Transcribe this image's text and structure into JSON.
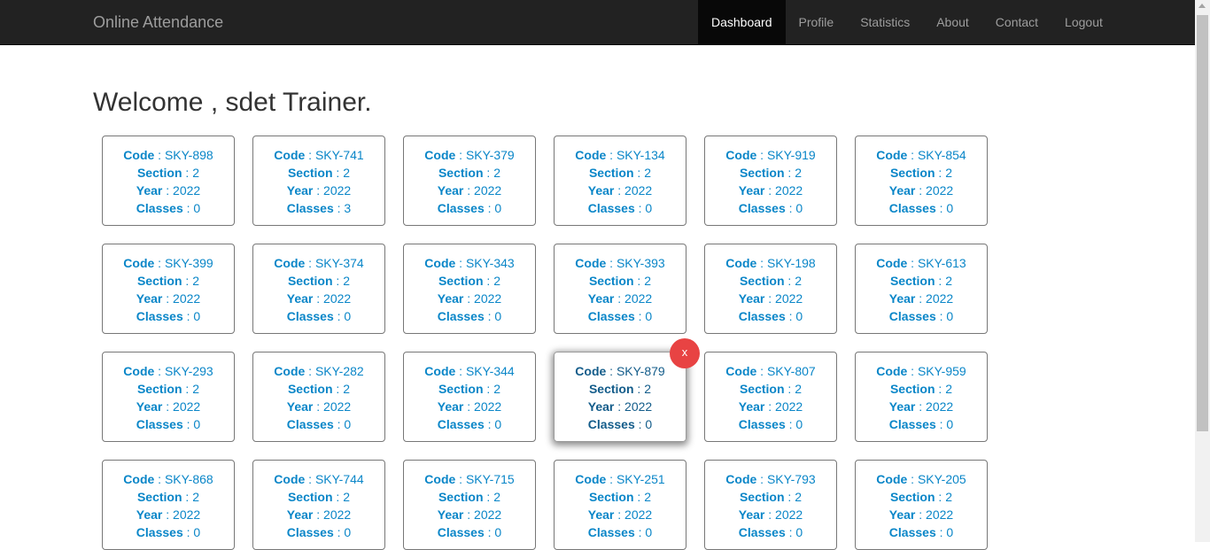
{
  "navbar": {
    "brand": "Online Attendance",
    "items": [
      {
        "label": "Dashboard",
        "active": true
      },
      {
        "label": "Profile"
      },
      {
        "label": "Statistics"
      },
      {
        "label": "About"
      },
      {
        "label": "Contact"
      },
      {
        "label": "Logout"
      }
    ]
  },
  "welcome": "Welcome , sdet Trainer.",
  "labels": {
    "code": "Code",
    "section": "Section",
    "year": "Year",
    "classes": "Classes",
    "sep": " : ",
    "delete": "x"
  },
  "cards": [
    {
      "code": "SKY-898",
      "section": "2",
      "year": "2022",
      "classes": "0"
    },
    {
      "code": "SKY-741",
      "section": "2",
      "year": "2022",
      "classes": "3"
    },
    {
      "code": "SKY-379",
      "section": "2",
      "year": "2022",
      "classes": "0"
    },
    {
      "code": "SKY-134",
      "section": "2",
      "year": "2022",
      "classes": "0"
    },
    {
      "code": "SKY-919",
      "section": "2",
      "year": "2022",
      "classes": "0"
    },
    {
      "code": "SKY-854",
      "section": "2",
      "year": "2022",
      "classes": "0"
    },
    {
      "code": "SKY-399",
      "section": "2",
      "year": "2022",
      "classes": "0"
    },
    {
      "code": "SKY-374",
      "section": "2",
      "year": "2022",
      "classes": "0"
    },
    {
      "code": "SKY-343",
      "section": "2",
      "year": "2022",
      "classes": "0"
    },
    {
      "code": "SKY-393",
      "section": "2",
      "year": "2022",
      "classes": "0"
    },
    {
      "code": "SKY-198",
      "section": "2",
      "year": "2022",
      "classes": "0"
    },
    {
      "code": "SKY-613",
      "section": "2",
      "year": "2022",
      "classes": "0"
    },
    {
      "code": "SKY-293",
      "section": "2",
      "year": "2022",
      "classes": "0"
    },
    {
      "code": "SKY-282",
      "section": "2",
      "year": "2022",
      "classes": "0"
    },
    {
      "code": "SKY-344",
      "section": "2",
      "year": "2022",
      "classes": "0"
    },
    {
      "code": "SKY-879",
      "section": "2",
      "year": "2022",
      "classes": "0",
      "hovered": true
    },
    {
      "code": "SKY-807",
      "section": "2",
      "year": "2022",
      "classes": "0"
    },
    {
      "code": "SKY-959",
      "section": "2",
      "year": "2022",
      "classes": "0"
    },
    {
      "code": "SKY-868",
      "section": "2",
      "year": "2022",
      "classes": "0"
    },
    {
      "code": "SKY-744",
      "section": "2",
      "year": "2022",
      "classes": "0"
    },
    {
      "code": "SKY-715",
      "section": "2",
      "year": "2022",
      "classes": "0"
    },
    {
      "code": "SKY-251",
      "section": "2",
      "year": "2022",
      "classes": "0"
    },
    {
      "code": "SKY-793",
      "section": "2",
      "year": "2022",
      "classes": "0"
    },
    {
      "code": "SKY-205",
      "section": "2",
      "year": "2022",
      "classes": "0"
    }
  ]
}
